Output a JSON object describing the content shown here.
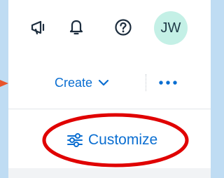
{
  "header": {
    "icons": [
      "announcement-icon",
      "bell-icon",
      "help-icon"
    ],
    "avatar_initials": "JW"
  },
  "toolbar": {
    "create_label": "Create",
    "more_icon": "more-icon"
  },
  "customize": {
    "label": "Customize",
    "icon": "sliders-icon"
  },
  "colors": {
    "background": "#bfdcf3",
    "accent": "#0a6ed1",
    "avatar_bg": "#c4f0e6",
    "annotation_red": "#e00000",
    "arrow_orange": "#e8542c"
  }
}
